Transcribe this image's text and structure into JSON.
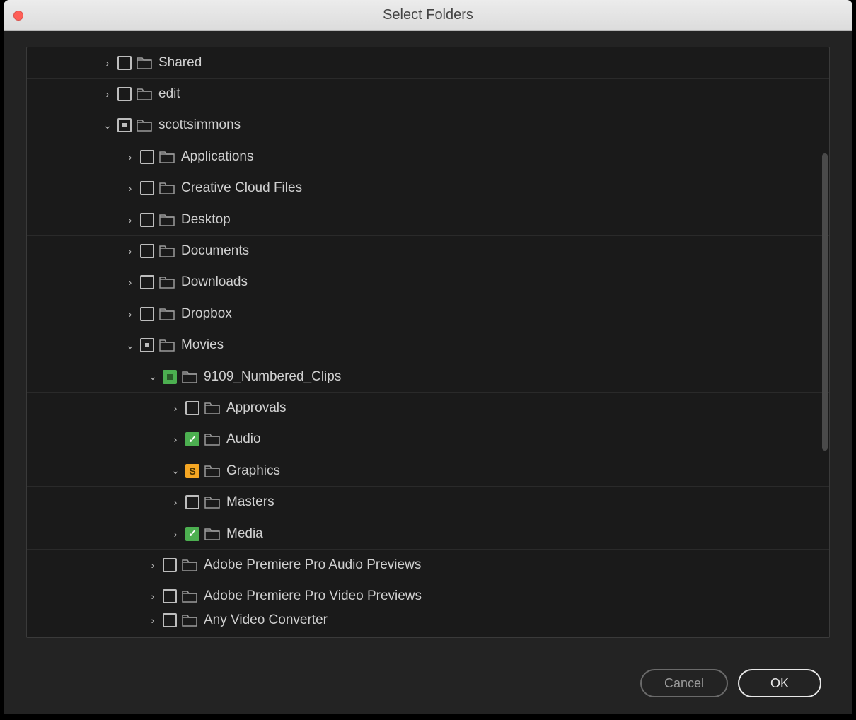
{
  "window": {
    "title": "Select Folders"
  },
  "tree": [
    {
      "level": 1,
      "expanded": false,
      "check": "empty",
      "label": "Shared"
    },
    {
      "level": 1,
      "expanded": false,
      "check": "empty",
      "label": "edit"
    },
    {
      "level": 1,
      "expanded": true,
      "check": "indeterminate",
      "label": "scottsimmons"
    },
    {
      "level": 2,
      "expanded": false,
      "check": "empty",
      "label": "Applications"
    },
    {
      "level": 2,
      "expanded": false,
      "check": "empty",
      "label": "Creative Cloud Files"
    },
    {
      "level": 2,
      "expanded": false,
      "check": "empty",
      "label": "Desktop"
    },
    {
      "level": 2,
      "expanded": false,
      "check": "empty",
      "label": "Documents"
    },
    {
      "level": 2,
      "expanded": false,
      "check": "empty",
      "label": "Downloads"
    },
    {
      "level": 2,
      "expanded": false,
      "check": "empty",
      "label": "Dropbox"
    },
    {
      "level": 2,
      "expanded": true,
      "check": "indeterminate",
      "label": "Movies"
    },
    {
      "level": 3,
      "expanded": true,
      "check": "green-partial",
      "label": "9109_Numbered_Clips"
    },
    {
      "level": 4,
      "expanded": false,
      "check": "empty",
      "label": "Approvals"
    },
    {
      "level": 4,
      "expanded": false,
      "check": "checked",
      "label": "Audio"
    },
    {
      "level": 4,
      "expanded": true,
      "check": "s-badge",
      "label": "Graphics"
    },
    {
      "level": 4,
      "expanded": false,
      "check": "empty",
      "label": "Masters"
    },
    {
      "level": 4,
      "expanded": false,
      "check": "checked",
      "label": "Media"
    },
    {
      "level": 3,
      "expanded": false,
      "check": "empty",
      "label": "Adobe Premiere Pro Audio Previews"
    },
    {
      "level": 3,
      "expanded": false,
      "check": "empty",
      "label": "Adobe Premiere Pro Video Previews"
    },
    {
      "level": 3,
      "expanded": false,
      "check": "empty",
      "label": "Any Video Converter",
      "clipped": true
    }
  ],
  "buttons": {
    "cancel": "Cancel",
    "ok": "OK"
  }
}
